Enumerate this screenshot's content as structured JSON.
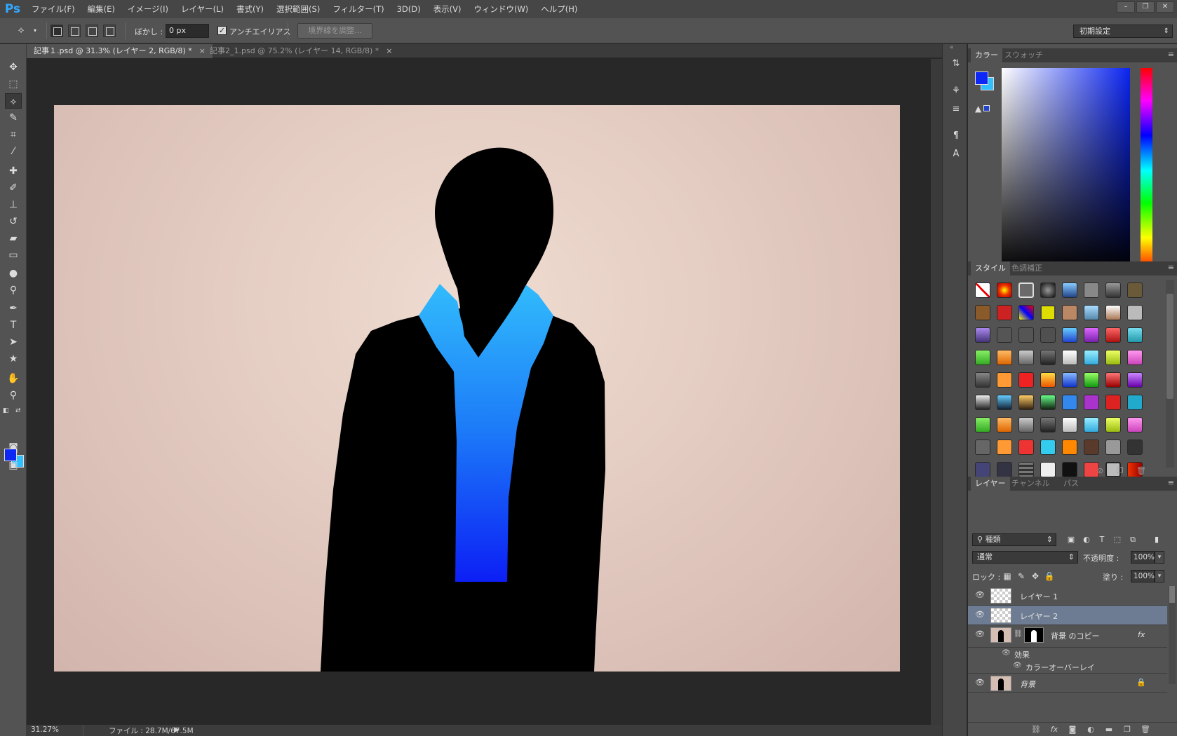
{
  "app": {
    "logo": "Ps"
  },
  "menu": [
    "ファイル(F)",
    "編集(E)",
    "イメージ(I)",
    "レイヤー(L)",
    "書式(Y)",
    "選択範囲(S)",
    "フィルター(T)",
    "3D(D)",
    "表示(V)",
    "ウィンドウ(W)",
    "ヘルプ(H)"
  ],
  "window_buttons": [
    "minimize-icon",
    "restore-icon",
    "close-icon"
  ],
  "options": {
    "tool_icon": "polygonal-lasso-icon",
    "feather_label": "ぼかし :",
    "feather_value": "0 px",
    "antialias_label": "アンチエイリアス",
    "antialias_checked": true,
    "refine_edge_label": "境界線を調整...",
    "workspace": "初期設定"
  },
  "tabs": [
    {
      "label": "記事１.psd @ 31.3% (レイヤー 2, RGB/8) *",
      "active": true
    },
    {
      "label": "記事2_1.psd @ 75.2% (レイヤー 14, RGB/8) *",
      "active": false
    }
  ],
  "tools": [
    "move-icon",
    "marquee-icon",
    "lasso-icon",
    "quick-select-icon",
    "crop-icon",
    "eyedropper-icon",
    "healing-brush-icon",
    "brush-icon",
    "clone-stamp-icon",
    "history-brush-icon",
    "eraser-icon",
    "gradient-icon",
    "blur-icon",
    "dodge-icon",
    "pen-icon",
    "type-icon",
    "path-select-icon",
    "shape-icon",
    "hand-icon",
    "zoom-icon"
  ],
  "colors": {
    "foreground": "#0d27f5",
    "background": "#31c0ff",
    "canvas_bg": "#282828",
    "selected_layer": "#6d7c93"
  },
  "status": {
    "zoom": "31.27%",
    "file": "ファイル : 28.7M/67.5M"
  },
  "color_panel": {
    "tabs": [
      "カラー",
      "スウォッチ"
    ]
  },
  "styles_panel": {
    "tabs": [
      "スタイル",
      "色調補正"
    ]
  },
  "layers_panel": {
    "tabs": [
      "レイヤー",
      "チャンネル",
      "パス"
    ],
    "filter": "種類",
    "blend_mode": "通常",
    "opacity_label": "不透明度 :",
    "opacity": "100%",
    "lock_label": "ロック :",
    "fill_label": "塗り :",
    "fill": "100%",
    "layers": [
      {
        "name": "レイヤー 1",
        "selected": false
      },
      {
        "name": "レイヤー 2",
        "selected": true
      },
      {
        "name": "背景 のコピー",
        "selected": false,
        "fx": "fx"
      },
      {
        "name": "効果",
        "sub": true
      },
      {
        "name": "カラーオーバーレイ",
        "sub": true
      },
      {
        "name": "背景",
        "selected": false,
        "locked": true
      }
    ]
  }
}
